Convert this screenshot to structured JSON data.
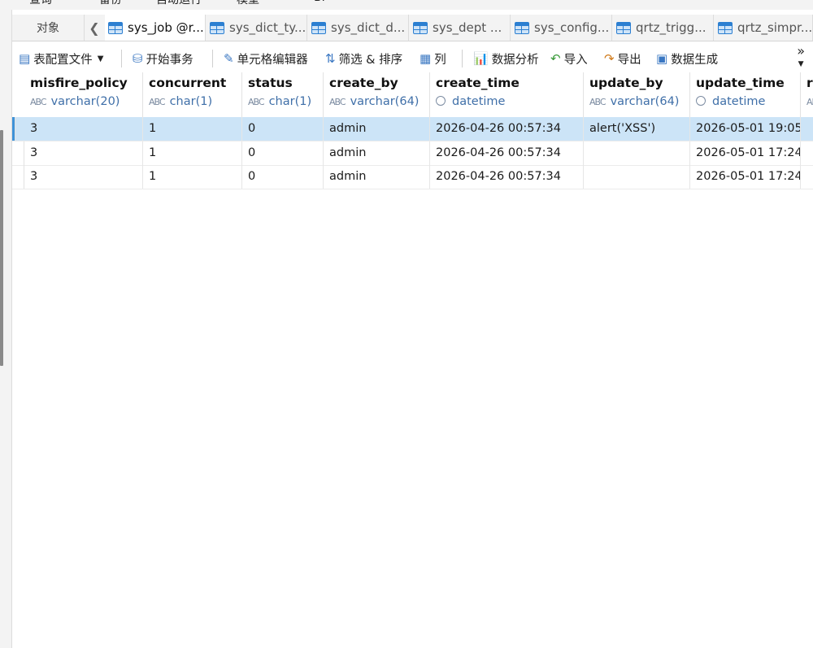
{
  "top_menu": [
    "查询",
    "备份",
    "自动运行",
    "模型",
    "BI"
  ],
  "tabs": {
    "objects_label": "对象",
    "back_glyph": "❮",
    "items": [
      {
        "label": "sys_job @r..."
      },
      {
        "label": "sys_dict_ty..."
      },
      {
        "label": "sys_dict_d..."
      },
      {
        "label": "sys_dept ..."
      },
      {
        "label": "sys_config..."
      },
      {
        "label": "qrtz_trigg..."
      },
      {
        "label": "qrtz_simpr..."
      }
    ]
  },
  "toolbar": {
    "table_config": "表配置文件",
    "begin_tx": "开始事务",
    "cell_editor": "单元格编辑器",
    "filter_sort": "筛选 & 排序",
    "columns": "列",
    "data_analysis": "数据分析",
    "import": "导入",
    "export": "导出",
    "data_gen": "数据生成",
    "more": "»"
  },
  "columns": [
    {
      "name": "misfire_policy",
      "type": "varchar(20)",
      "kind": "text"
    },
    {
      "name": "concurrent",
      "type": "char(1)",
      "kind": "text"
    },
    {
      "name": "status",
      "type": "char(1)",
      "kind": "text"
    },
    {
      "name": "create_by",
      "type": "varchar(64)",
      "kind": "text"
    },
    {
      "name": "create_time",
      "type": "datetime",
      "kind": "datetime"
    },
    {
      "name": "update_by",
      "type": "varchar(64)",
      "kind": "text"
    },
    {
      "name": "update_time",
      "type": "datetime",
      "kind": "datetime"
    },
    {
      "name": "r",
      "type": "",
      "kind": "text"
    }
  ],
  "rows": [
    {
      "selected": true,
      "cells": [
        "3",
        "1",
        "0",
        "admin",
        "2026-04-26 00:57:34",
        "alert('XSS')",
        "2026-05-01 19:05",
        ""
      ]
    },
    {
      "selected": false,
      "cells": [
        "3",
        "1",
        "0",
        "admin",
        "2026-04-26 00:57:34",
        "",
        "2026-05-01 17:24",
        ""
      ]
    },
    {
      "selected": false,
      "cells": [
        "3",
        "1",
        "0",
        "admin",
        "2026-04-26 00:57:34",
        "",
        "2026-05-01 17:24",
        ""
      ]
    }
  ]
}
